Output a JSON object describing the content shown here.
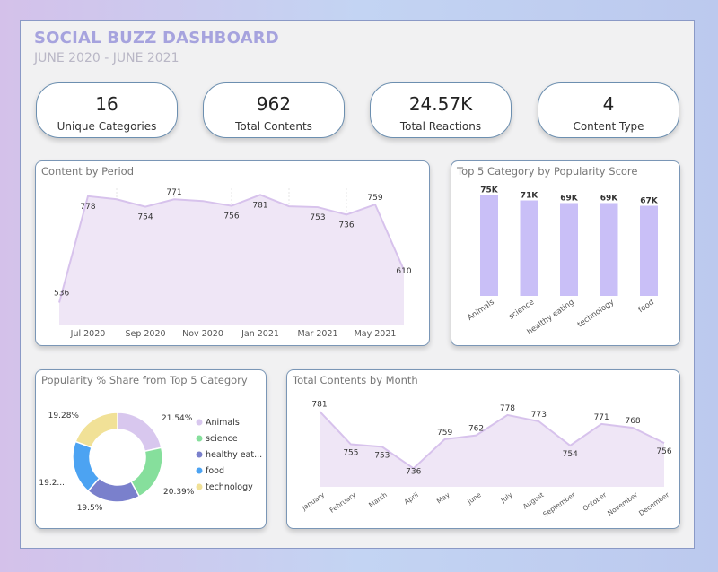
{
  "header": {
    "title": "SOCIAL BUZZ DASHBOARD",
    "subtitle": "JUNE 2020 - JUNE 2021"
  },
  "kpis": [
    {
      "value": "16",
      "label": "Unique Categories"
    },
    {
      "value": "962",
      "label": "Total Contents"
    },
    {
      "value": "24.57K",
      "label": "Total Reactions"
    },
    {
      "value": "4",
      "label": "Content Type"
    }
  ],
  "colors": {
    "area_fill": "#efe6f6",
    "area_line": "#d7c2ec",
    "bar": "#c9bff7",
    "pie": [
      "#d8c7ee",
      "#86df9c",
      "#7a80cc",
      "#4ca3f2",
      "#f1e197"
    ]
  },
  "chart_data": [
    {
      "type": "area",
      "title": "Content by Period",
      "x": [
        "Jun 2020",
        "Jul 2020",
        "Aug 2020",
        "Sep 2020",
        "Oct 2020",
        "Nov 2020",
        "Dec 2020",
        "Jan 2021",
        "Feb 2021",
        "Mar 2021",
        "Apr 2021",
        "May 2021",
        "Jun 2021"
      ],
      "values": [
        536,
        778,
        771,
        754,
        771,
        767,
        756,
        781,
        755,
        753,
        736,
        759,
        610
      ],
      "point_labels": [
        "536",
        "778",
        "",
        "754",
        "771",
        "",
        "756",
        "781",
        "",
        "753",
        "736",
        "759",
        "610"
      ],
      "x_ticks": [
        "Jul 2020",
        "Sep 2020",
        "Nov 2020",
        "Jan 2021",
        "Mar 2021",
        "May 2021"
      ],
      "x_tick_index": [
        1,
        3,
        5,
        7,
        9,
        11
      ]
    },
    {
      "type": "bar",
      "title": "Top 5 Category by Popularity Score",
      "categories": [
        "Animals",
        "science",
        "healthy eating",
        "technology",
        "food"
      ],
      "values": [
        75,
        71,
        69,
        69,
        67
      ],
      "value_labels": [
        "75K",
        "71K",
        "69K",
        "69K",
        "67K"
      ],
      "unit": "K"
    },
    {
      "type": "pie",
      "title": "Popularity % Share from Top 5 Category",
      "categories": [
        "Animals",
        "science",
        "healthy eat...",
        "food",
        "technology"
      ],
      "values": [
        21.54,
        20.39,
        19.5,
        19.29,
        19.28
      ],
      "slice_labels": [
        "21.54%",
        "20.39%",
        "19.5%",
        "19.2...",
        "19.28%"
      ]
    },
    {
      "type": "area",
      "title": "Total Contents by Month",
      "categories": [
        "January",
        "February",
        "March",
        "April",
        "May",
        "June",
        "July",
        "August",
        "September",
        "October",
        "November",
        "December"
      ],
      "values": [
        781,
        755,
        753,
        736,
        759,
        762,
        778,
        773,
        754,
        771,
        768,
        756
      ]
    }
  ]
}
